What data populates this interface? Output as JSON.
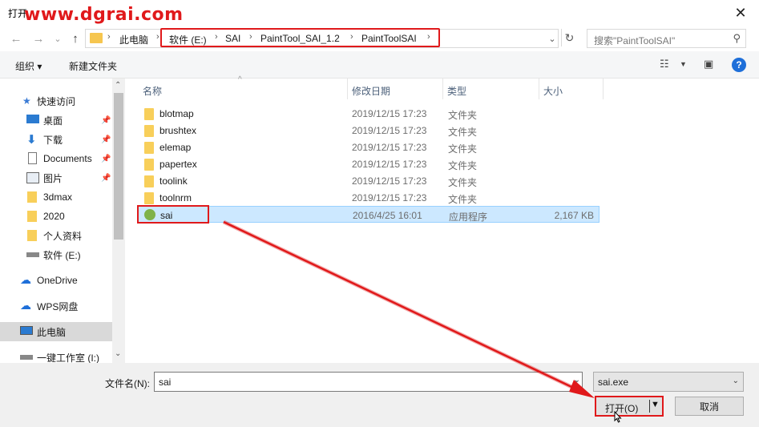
{
  "window": {
    "title": "打开",
    "watermark": "www.dgrai.com",
    "close_glyph": "✕"
  },
  "nav": {
    "back_glyph": "←",
    "forward_glyph": "→",
    "recent_glyph": "⌄",
    "up_glyph": "↑",
    "breadcrumb": [
      "此电脑",
      "软件 (E:)",
      "SAI",
      "PaintTool_SAI_1.2",
      "PaintToolSAI"
    ],
    "search_placeholder": "搜索\"PaintToolSAI\""
  },
  "toolbar": {
    "organize": "组织 ▾",
    "new_folder": "新建文件夹",
    "help": "?"
  },
  "sidebar": {
    "items": [
      {
        "label": "快速访问",
        "icon": "star-icon"
      },
      {
        "label": "桌面",
        "icon": "desktop-icon",
        "pinned": true
      },
      {
        "label": "下载",
        "icon": "download-icon",
        "pinned": true
      },
      {
        "label": "Documents",
        "icon": "document-icon",
        "pinned": true
      },
      {
        "label": "图片",
        "icon": "picture-icon",
        "pinned": true
      },
      {
        "label": "3dmax",
        "icon": "folder-icon"
      },
      {
        "label": "2020",
        "icon": "folder-icon"
      },
      {
        "label": "个人资料",
        "icon": "folder-icon"
      },
      {
        "label": "软件 (E:)",
        "icon": "drive-icon"
      },
      {
        "label": "OneDrive",
        "icon": "cloud-icon"
      },
      {
        "label": "WPS网盘",
        "icon": "cloud-icon"
      },
      {
        "label": "此电脑",
        "icon": "computer-icon",
        "selected": true
      },
      {
        "label": "一键工作室 (I:)",
        "icon": "drive-icon"
      }
    ]
  },
  "columns": {
    "name": "名称",
    "date": "修改日期",
    "type": "类型",
    "size": "大小"
  },
  "files": [
    {
      "name": "blotmap",
      "date": "2019/12/15 17:23",
      "type": "文件夹",
      "size": ""
    },
    {
      "name": "brushtex",
      "date": "2019/12/15 17:23",
      "type": "文件夹",
      "size": ""
    },
    {
      "name": "elemap",
      "date": "2019/12/15 17:23",
      "type": "文件夹",
      "size": ""
    },
    {
      "name": "papertex",
      "date": "2019/12/15 17:23",
      "type": "文件夹",
      "size": ""
    },
    {
      "name": "toolink",
      "date": "2019/12/15 17:23",
      "type": "文件夹",
      "size": ""
    },
    {
      "name": "toolnrm",
      "date": "2019/12/15 17:23",
      "type": "文件夹",
      "size": ""
    },
    {
      "name": "sai",
      "date": "2016/4/25 16:01",
      "type": "应用程序",
      "size": "2,167 KB",
      "selected": true
    }
  ],
  "footer": {
    "filename_label": "文件名(N):",
    "filename_value": "sai",
    "filetype_value": "sai.exe",
    "open_label": "打开(O)",
    "cancel_label": "取消"
  },
  "colors": {
    "annotation": "#e0191b",
    "selection": "#cce8ff",
    "accent": "#1e6fd9"
  }
}
